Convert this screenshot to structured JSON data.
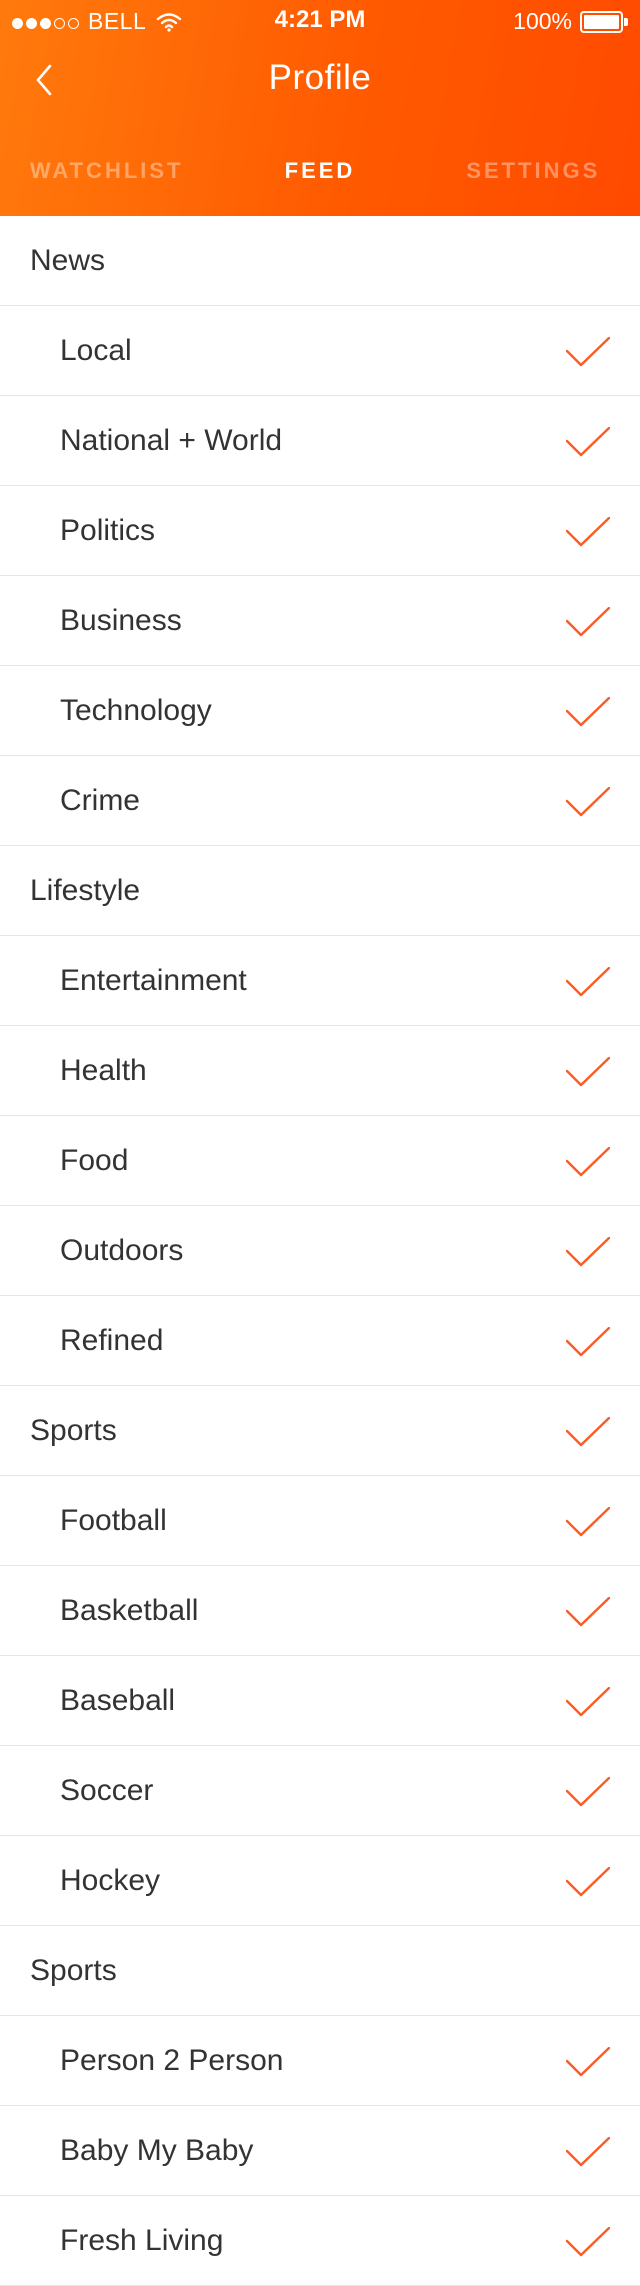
{
  "status_bar": {
    "signal_dots_filled": 3,
    "signal_dots_total": 5,
    "carrier": "BELL",
    "time": "4:21 PM",
    "battery": "100%",
    "battery_level": 1.0
  },
  "nav": {
    "title": "Profile",
    "back_icon": "chevron-left-icon"
  },
  "tabs": [
    {
      "label": "WATCHLIST",
      "active": false
    },
    {
      "label": "FEED",
      "active": true
    },
    {
      "label": "SETTINGS",
      "active": false
    }
  ],
  "colors": {
    "header_start": "#ff7a0d",
    "header_end": "#ff4a00",
    "check": "#ff5a1f",
    "divider": "#e6e6e6",
    "text": "#333333"
  },
  "feed": [
    {
      "type": "section",
      "label": "News",
      "checked": false
    },
    {
      "type": "item",
      "label": "Local",
      "checked": true
    },
    {
      "type": "item",
      "label": "National + World",
      "checked": true
    },
    {
      "type": "item",
      "label": "Politics",
      "checked": true
    },
    {
      "type": "item",
      "label": "Business",
      "checked": true
    },
    {
      "type": "item",
      "label": "Technology",
      "checked": true
    },
    {
      "type": "item",
      "label": "Crime",
      "checked": true
    },
    {
      "type": "section",
      "label": "Lifestyle",
      "checked": false
    },
    {
      "type": "item",
      "label": "Entertainment",
      "checked": true
    },
    {
      "type": "item",
      "label": "Health",
      "checked": true
    },
    {
      "type": "item",
      "label": "Food",
      "checked": true
    },
    {
      "type": "item",
      "label": "Outdoors",
      "checked": true
    },
    {
      "type": "item",
      "label": "Refined",
      "checked": true
    },
    {
      "type": "section",
      "label": "Sports",
      "checked": true
    },
    {
      "type": "item",
      "label": "Football",
      "checked": true
    },
    {
      "type": "item",
      "label": "Basketball",
      "checked": true
    },
    {
      "type": "item",
      "label": "Baseball",
      "checked": true
    },
    {
      "type": "item",
      "label": "Soccer",
      "checked": true
    },
    {
      "type": "item",
      "label": "Hockey",
      "checked": true
    },
    {
      "type": "section",
      "label": "Sports",
      "checked": false
    },
    {
      "type": "item",
      "label": "Person 2 Person",
      "checked": true
    },
    {
      "type": "item",
      "label": "Baby My Baby",
      "checked": true
    },
    {
      "type": "item",
      "label": "Fresh Living",
      "checked": true
    }
  ]
}
